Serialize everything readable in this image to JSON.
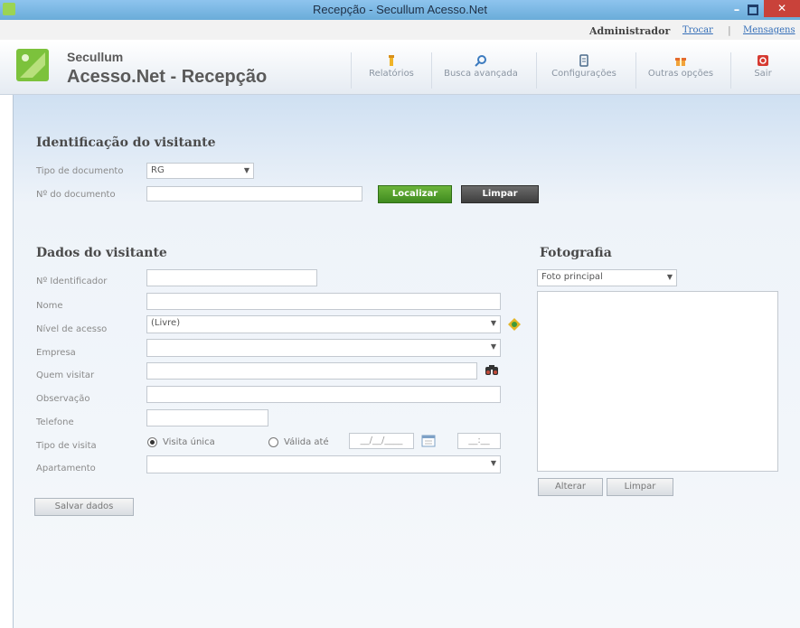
{
  "window": {
    "title": "Recepção - Secullum Acesso.Net",
    "minimize": "–",
    "close": "✕"
  },
  "user": {
    "name": "Administrador",
    "switch_link": "Trocar",
    "separator": "|",
    "messages_link": "Mensagens"
  },
  "brand": {
    "line1": "Secullum",
    "line2": "Acesso.Net - Recepção"
  },
  "nav": {
    "items": [
      {
        "label": "Relatórios",
        "icon": "reports-icon"
      },
      {
        "label": "Busca avançada",
        "icon": "search-icon"
      },
      {
        "label": "Configurações",
        "icon": "settings-icon"
      },
      {
        "label": "Outras opções",
        "icon": "options-icon"
      },
      {
        "label": "Sair",
        "icon": "exit-icon"
      }
    ]
  },
  "identification": {
    "heading": "Identificação do visitante",
    "doc_type_label": "Tipo de documento",
    "doc_type_value": "RG",
    "doc_number_label": "Nº do documento",
    "doc_number_value": "",
    "find_button": "Localizar",
    "clear_button": "Limpar"
  },
  "visitor": {
    "heading": "Dados do visitante",
    "id_label": "Nº Identificador",
    "name_label": "Nome",
    "access_label": "Nível de acesso",
    "access_value": "(Livre)",
    "company_label": "Empresa",
    "host_label": "Quem visitar",
    "note_label": "Observação",
    "phone_label": "Telefone",
    "visit_type_label": "Tipo de visita",
    "visit_single": "Visita única",
    "visit_valid_until": "Válida até",
    "date_placeholder": "__/__/____",
    "time_placeholder": "__:__",
    "apartment_label": "Apartamento",
    "save_button": "Salvar dados"
  },
  "photo": {
    "heading": "Fotografia",
    "select_value": "Foto principal",
    "change_button": "Alterar",
    "clear_button": "Limpar"
  },
  "colors": {
    "accent_green": "#4f9e2a",
    "title_bar": "#7bb8e4",
    "close_red": "#c9423a",
    "link_blue": "#356fb8"
  }
}
